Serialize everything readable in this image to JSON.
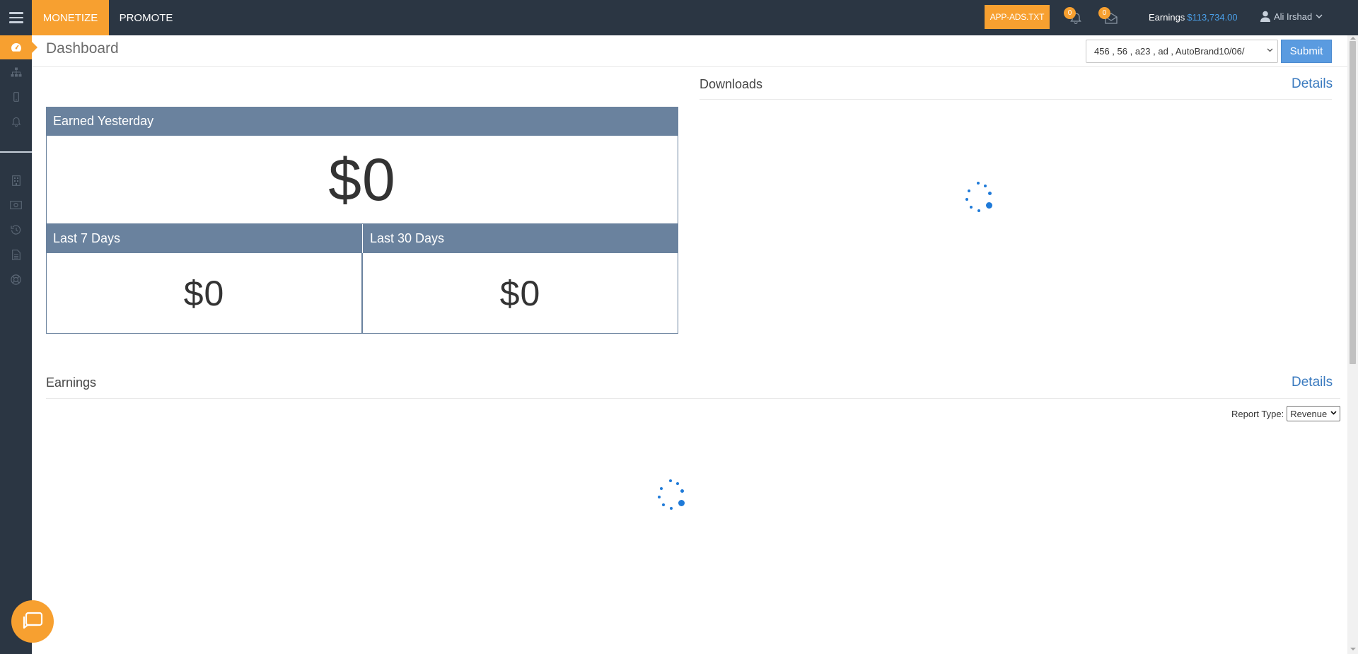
{
  "topbar": {
    "tabs": [
      {
        "label": "MONETIZE",
        "active": true
      },
      {
        "label": "PROMOTE",
        "active": false
      }
    ],
    "app_ads_label": "APP-ADS.TXT",
    "notifications_count": "0",
    "messages_count": "0",
    "earnings_label": "Earnings",
    "earnings_amount": "$113,734.00",
    "user_name": "Ali Irshad"
  },
  "sidebar": {
    "items": [
      {
        "icon": "dashboard-icon",
        "active": true
      },
      {
        "icon": "sitemap-icon",
        "active": false
      },
      {
        "icon": "mobile-icon",
        "active": false
      },
      {
        "icon": "bell-icon",
        "active": false
      },
      {
        "icon": "building-icon",
        "active": false
      },
      {
        "icon": "money-icon",
        "active": false
      },
      {
        "icon": "history-icon",
        "active": false
      },
      {
        "icon": "document-icon",
        "active": false
      },
      {
        "icon": "support-icon",
        "active": false
      }
    ]
  },
  "header": {
    "title": "Dashboard",
    "app_select_value": "456 , 56 , a23 , ad , AutoBrand10/06/",
    "submit_label": "Submit"
  },
  "earnings_box": {
    "yesterday_label": "Earned Yesterday",
    "yesterday_value": "$0",
    "last7_label": "Last 7 Days",
    "last7_value": "$0",
    "last30_label": "Last 30 Days",
    "last30_value": "$0"
  },
  "downloads": {
    "title": "Downloads",
    "details_label": "Details"
  },
  "earnings_section": {
    "title": "Earnings",
    "details_label": "Details",
    "report_type_label": "Report Type:",
    "report_type_value": "Revenue"
  },
  "colors": {
    "topbar_bg": "#2b3643",
    "accent_orange": "#f7a030",
    "panel_header": "#6a829e",
    "link_blue": "#3a7abf",
    "spinner_blue": "#1f7ad8"
  }
}
